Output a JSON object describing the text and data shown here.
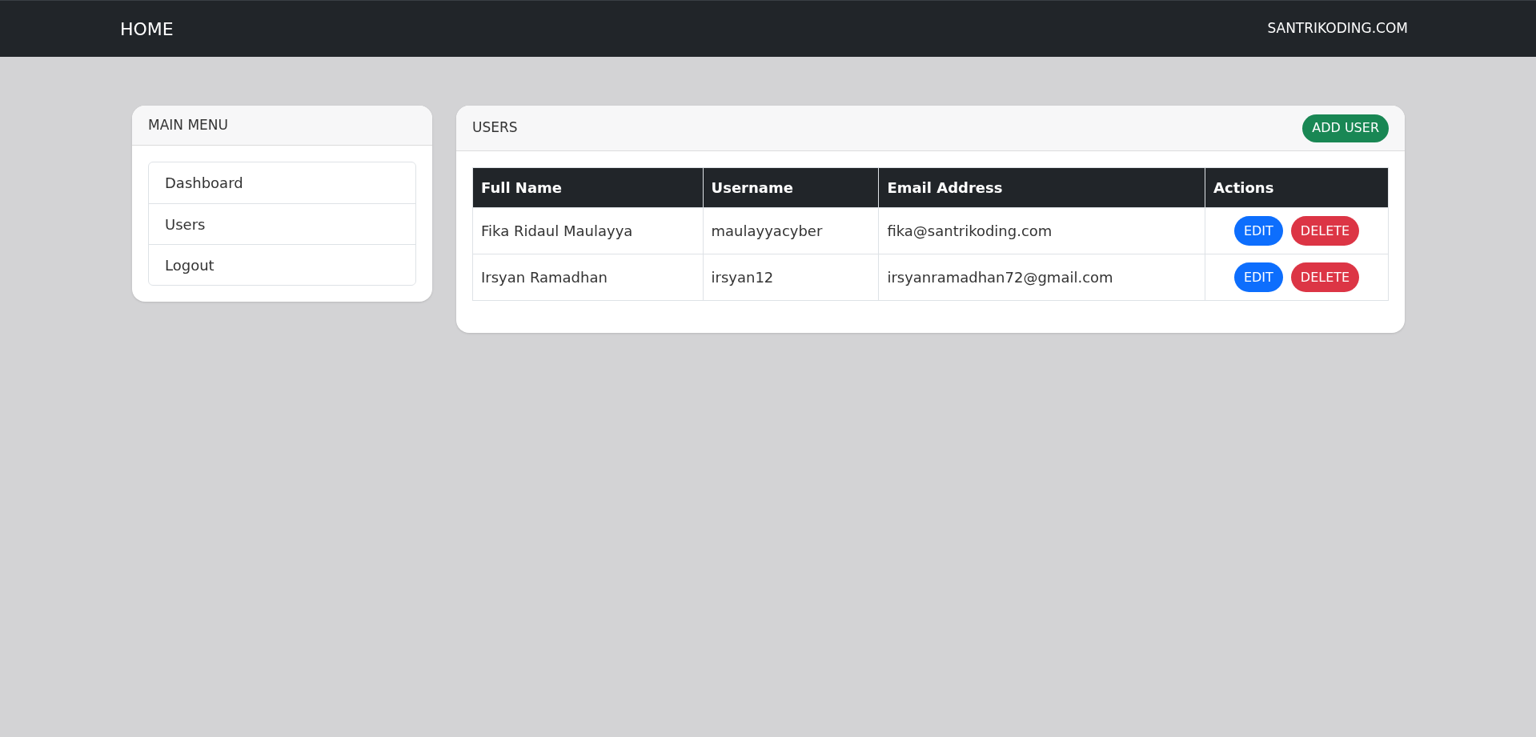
{
  "navbar": {
    "brand": "HOME",
    "link": "SANTRIKODING.COM"
  },
  "menu": {
    "title": "MAIN MENU",
    "items": [
      "Dashboard",
      "Users",
      "Logout"
    ]
  },
  "users": {
    "title": "USERS",
    "add_button": "ADD USER",
    "table": {
      "columns": [
        "Full Name",
        "Username",
        "Email Address",
        "Actions"
      ],
      "rows": [
        {
          "full_name": "Fika Ridaul Maulayya",
          "username": "maulayyacyber",
          "email": "fika@santrikoding.com",
          "actions": [
            "EDIT",
            "DELETE"
          ]
        },
        {
          "full_name": "Irsyan Ramadhan",
          "username": "irsyan12",
          "email": "irsyanramadhan72@gmail.com",
          "actions": [
            "EDIT",
            "DELETE"
          ]
        }
      ]
    }
  }
}
